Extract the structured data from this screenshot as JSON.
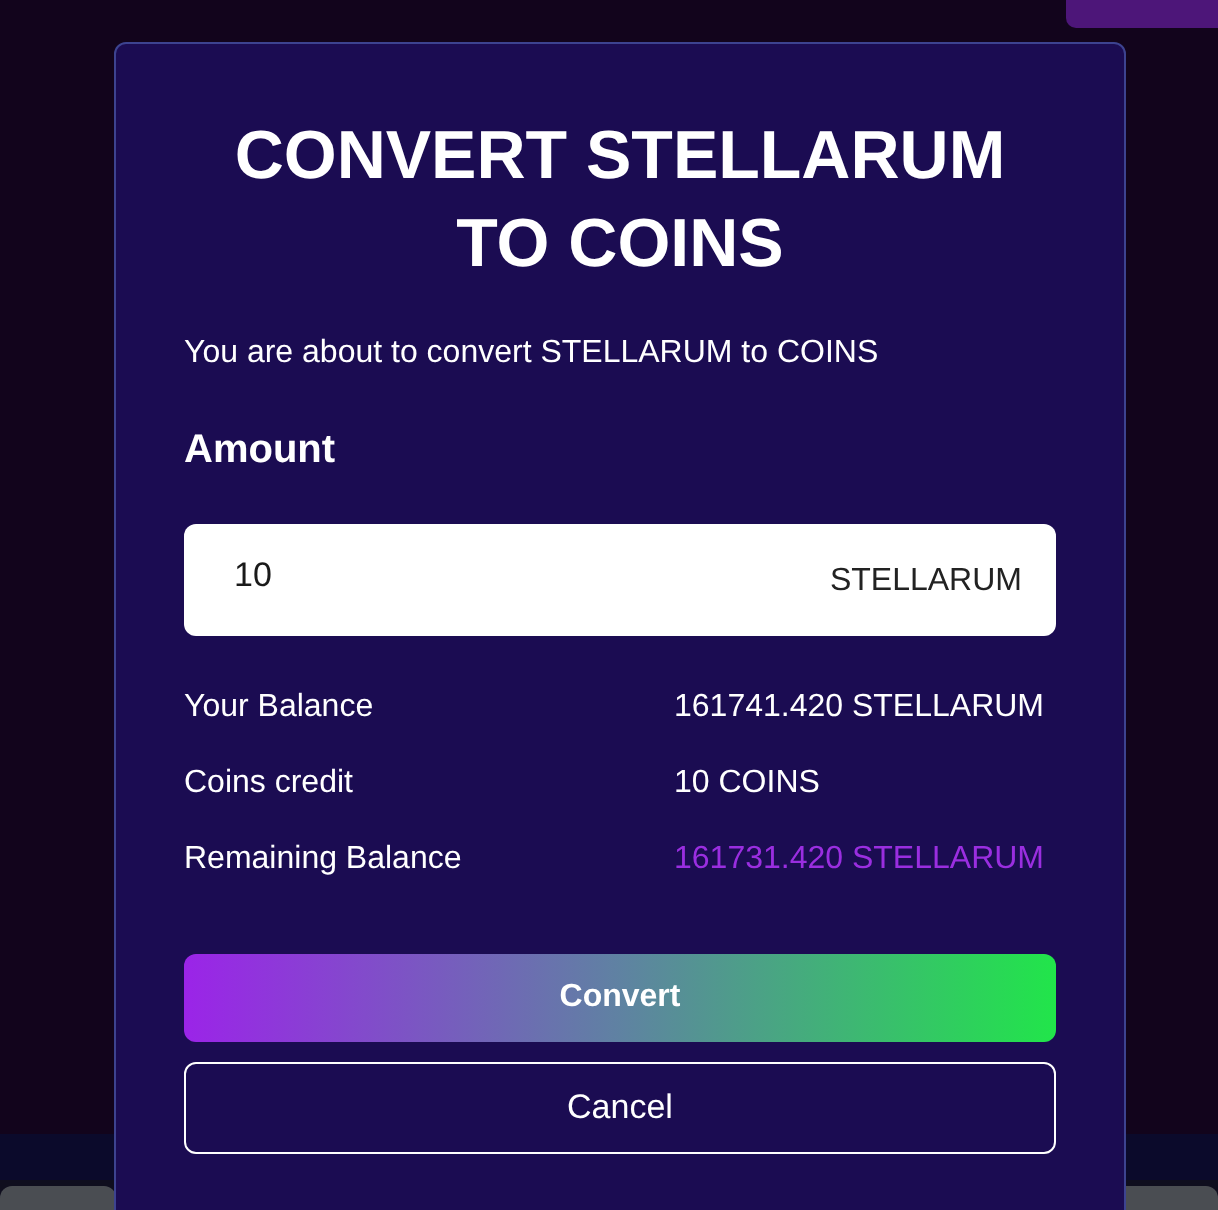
{
  "dialog": {
    "title": "CONVERT STELLARUM TO COINS",
    "description": "You are about to convert STELLARUM to COINS",
    "amount_label": "Amount",
    "amount_field": {
      "value": "10",
      "unit": "STELLARUM"
    },
    "summary": [
      {
        "label": "Your Balance",
        "value": "161741.420 STELLARUM",
        "kind": "normal"
      },
      {
        "label": "Coins credit",
        "value": "10 COINS",
        "kind": "normal"
      },
      {
        "label": "Remaining Balance",
        "value": "161731.420 STELLARUM",
        "kind": "highlight"
      }
    ],
    "buttons": [
      {
        "label": "Convert",
        "kind": "primary"
      },
      {
        "label": "Cancel",
        "kind": "secondary"
      }
    ]
  }
}
